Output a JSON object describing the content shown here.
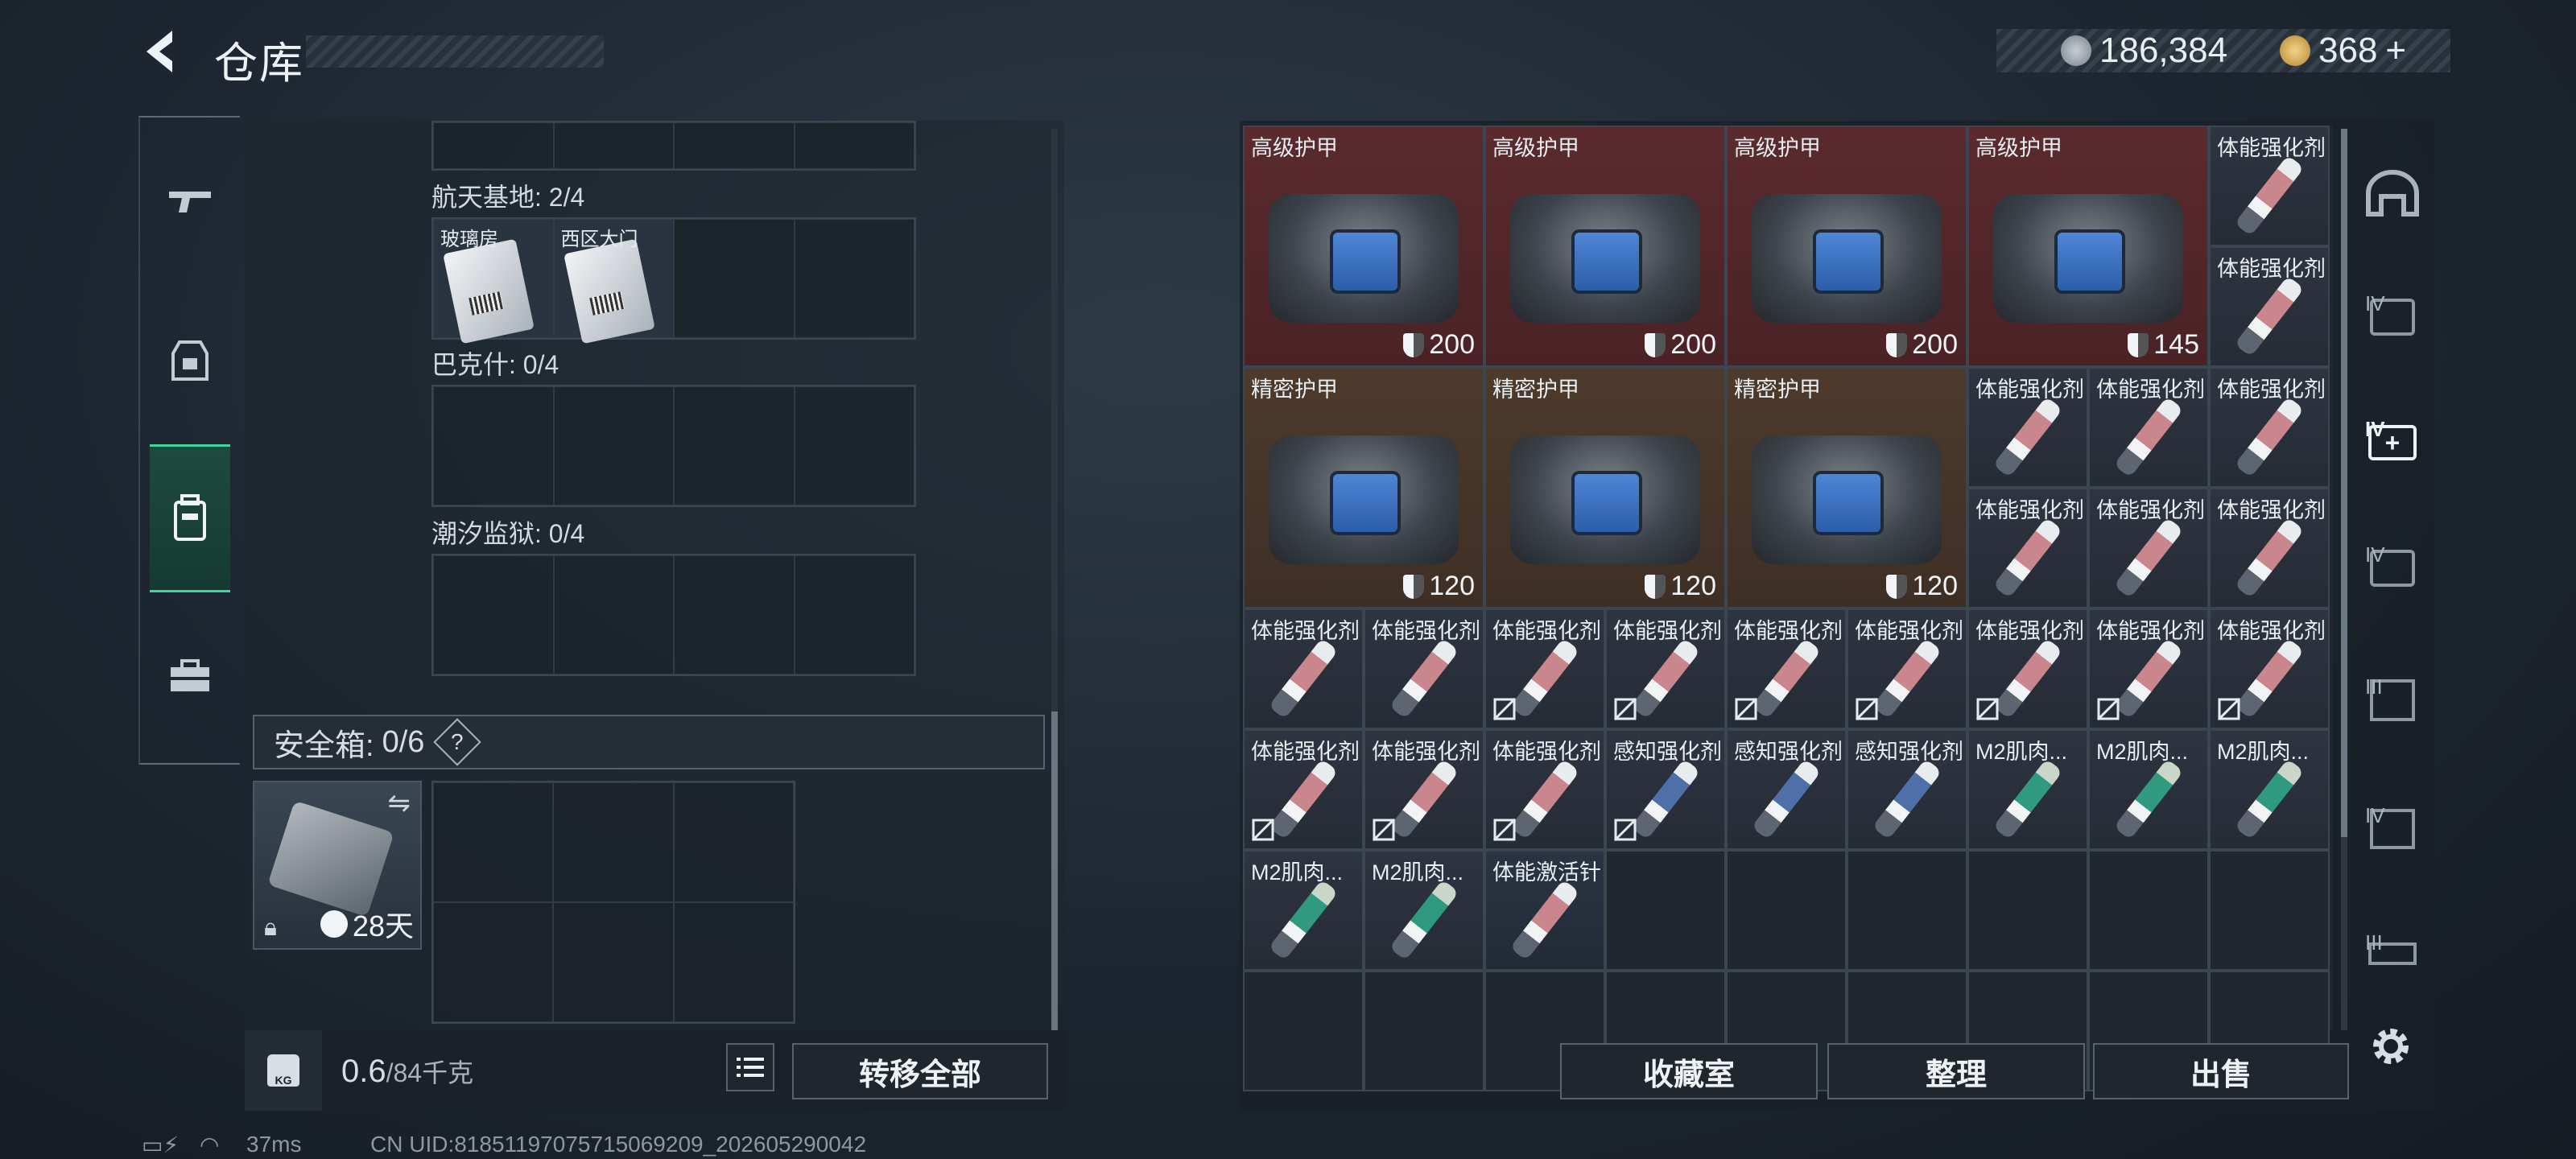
{
  "header": {
    "title": "仓库",
    "silver": "186,384",
    "gold": "368",
    "gold_plus": "+"
  },
  "keycards": {
    "section1_label": "航天基地: 2/4",
    "section1_cards": [
      "玻璃房",
      "西区大门"
    ],
    "section2_label": "巴克什: 0/4",
    "section3_label": "潮汐监狱: 0/4"
  },
  "safebox": {
    "label": "安全箱:",
    "count": "0/6",
    "help": "?",
    "timer": "28天"
  },
  "footer_left": {
    "weight_value": "0.6",
    "weight_max": "/84千克",
    "transfer_all": "转移全部",
    "kg_icon": "KG"
  },
  "footer_right": {
    "collection": "收藏室",
    "sort": "整理",
    "sell": "出售"
  },
  "inventory": {
    "armor": [
      {
        "name": "高级护甲",
        "durability": "200"
      },
      {
        "name": "高级护甲",
        "durability": "200"
      },
      {
        "name": "高级护甲",
        "durability": "200"
      },
      {
        "name": "高级护甲",
        "durability": "145"
      },
      {
        "name": "精密护甲",
        "durability": "120"
      },
      {
        "name": "精密护甲",
        "durability": "120"
      },
      {
        "name": "精密护甲",
        "durability": "120"
      }
    ],
    "consumables": [
      {
        "name": "体能强化剂"
      },
      {
        "name": "体能强化剂"
      },
      {
        "name": "体能强化剂"
      },
      {
        "name": "体能强化剂"
      },
      {
        "name": "体能强化剂"
      },
      {
        "name": "体能强化剂"
      },
      {
        "name": "体能强化剂"
      },
      {
        "name": "体能强化剂"
      },
      {
        "name": "体能强化剂"
      },
      {
        "name": "体能强化剂"
      },
      {
        "name": "体能强化剂"
      },
      {
        "name": "体能强化剂"
      },
      {
        "name": "体能强化剂"
      },
      {
        "name": "体能强化剂"
      },
      {
        "name": "体能强化剂"
      },
      {
        "name": "体能强化剂"
      },
      {
        "name": "体能强化剂"
      },
      {
        "name": "体能强化剂"
      },
      {
        "name": "体能强化剂"
      },
      {
        "name": "体能强化剂"
      },
      {
        "name": "感知强化剂"
      },
      {
        "name": "感知强化剂"
      },
      {
        "name": "感知强化剂"
      },
      {
        "name": "M2肌肉..."
      },
      {
        "name": "M2肌肉..."
      },
      {
        "name": "M2肌肉..."
      },
      {
        "name": "M2肌肉..."
      },
      {
        "name": "M2肌肉..."
      },
      {
        "name": "体能激活针"
      }
    ]
  },
  "status": {
    "ping": "37ms",
    "uid": "CN UID:818511970757150692​09_202605290042"
  },
  "right_nav_labels": [
    "IV",
    "IV",
    "IV",
    "III",
    "IV",
    "III"
  ],
  "colors": {
    "accent": "#3ed69a",
    "armor_high": "#5a2a2e",
    "armor_precise": "#4d3a2c"
  }
}
